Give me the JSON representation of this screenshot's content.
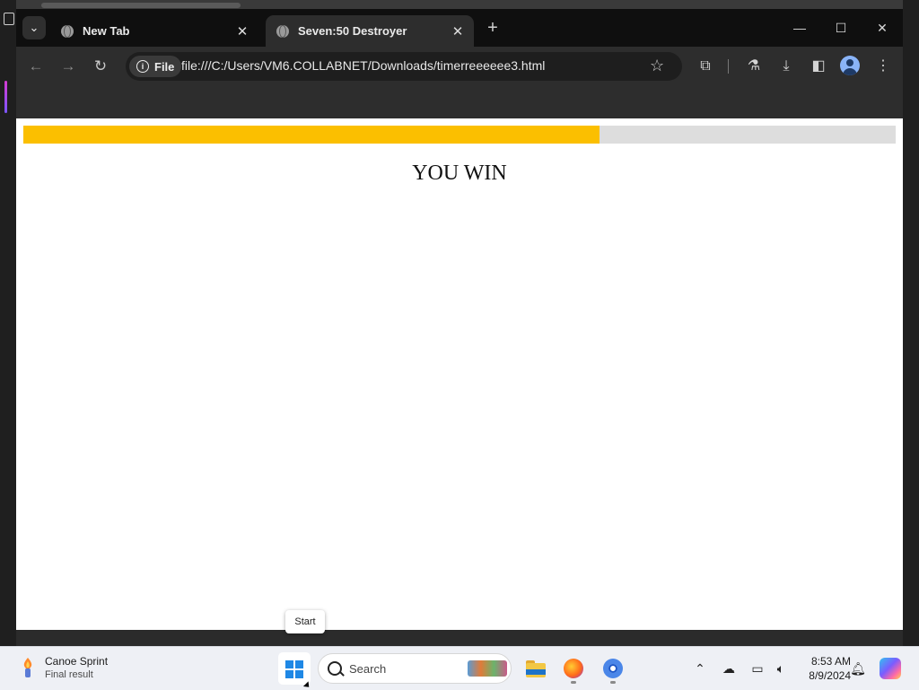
{
  "browser": {
    "tabs": [
      {
        "title": "New Tab",
        "active": false
      },
      {
        "title": "Seven:50 Destroyer",
        "active": true
      }
    ],
    "address": {
      "scheme_chip": "File",
      "url": "file:///C:/Users/VM6.COLLABNET/Downloads/timerreeeeee3.html"
    }
  },
  "page": {
    "progress": {
      "fraction": 0.66,
      "fill_color": "#fbbf00",
      "track_color": "#dddddd"
    },
    "result_text": "YOU WIN"
  },
  "tooltip": {
    "text": "Start"
  },
  "taskbar": {
    "weather": {
      "title": "Canoe Sprint",
      "subtitle": "Final result"
    },
    "search_placeholder": "Search",
    "clock": {
      "time": "8:53 AM",
      "date": "8/9/2024"
    }
  }
}
